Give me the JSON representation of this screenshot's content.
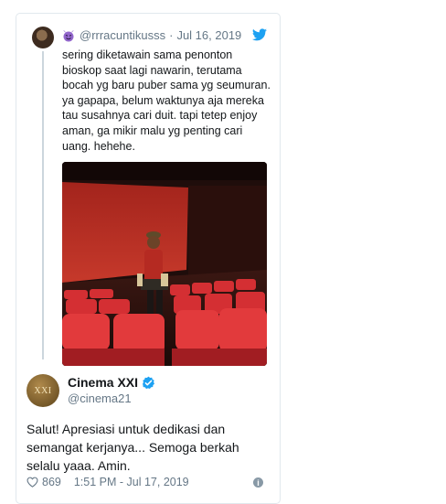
{
  "quoted": {
    "handle": "@rrracuntikusss",
    "separator": "·",
    "date": "Jul 16, 2019",
    "text": "sering diketawain sama penonton\nbioskop saat lagi nawarin, terutama\nbocah yg baru puber sama yg seumuran.\nya gapapa, belum waktunya aja mereka\ntau susahnya cari duit. tapi tetep enjoy\naman, ga mikir malu yg penting cari\nuang. hehehe."
  },
  "reply": {
    "avatar_text": "XXI",
    "name": "Cinema XXI",
    "handle": "@cinema21",
    "text": "Salut! Apresiasi untuk dedikasi dan semangat kerjanya... Semoga berkah selalu yaaa. Amin.",
    "likes": "869",
    "timestamp": "1:51 PM - Jul 17, 2019"
  },
  "icons": {
    "emoji": "smiling-devil-icon",
    "brand": "twitter-bird-icon",
    "verified": "verified-badge-icon",
    "like": "heart-icon",
    "info": "info-icon"
  },
  "colors": {
    "twitter_blue": "#1da1f2",
    "text": "#14171a",
    "muted": "#657786",
    "border": "#e1e8ed",
    "emoji_purple": "#9266cc"
  }
}
